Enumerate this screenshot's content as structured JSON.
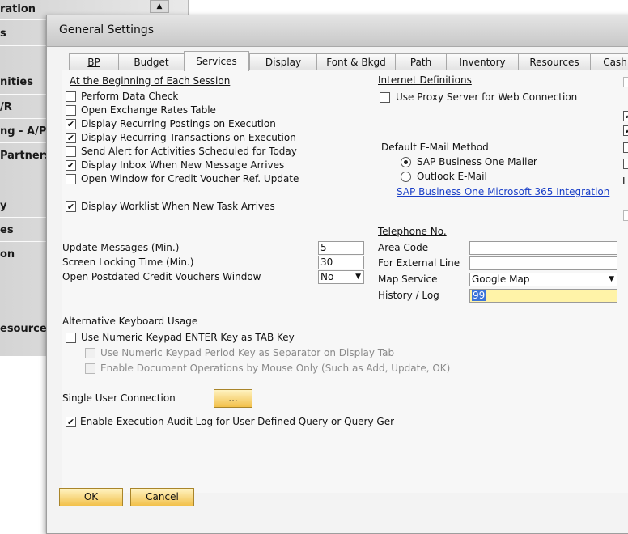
{
  "background": {
    "sidebar_items": [
      "ration",
      "s",
      "nities",
      "/R",
      "ng - A/P",
      " Partners",
      "y",
      "es",
      "on",
      "esource"
    ],
    "scroll_icon": "triangle-up"
  },
  "dialog": {
    "title": "General Settings",
    "tabs": [
      "BP",
      "Budget",
      "Services",
      "Display",
      "Font & Bkgd",
      "Path",
      "Inventory",
      "Resources",
      "Cash"
    ],
    "active_tab": "Services"
  },
  "session": {
    "heading": "At the Beginning of Each Session",
    "options": [
      {
        "label": "Perform Data Check",
        "checked": false
      },
      {
        "label": "Open Exchange Rates Table",
        "checked": false
      },
      {
        "label": "Display Recurring Postings on Execution",
        "checked": true
      },
      {
        "label": "Display Recurring Transactions on Execution",
        "checked": true
      },
      {
        "label": "Send Alert for Activities Scheduled for Today",
        "checked": false
      },
      {
        "label": "Display Inbox When New Message Arrives",
        "checked": true
      },
      {
        "label": "Open Window for Credit Voucher Ref. Update",
        "checked": false
      }
    ],
    "worklist": {
      "label": "Display Worklist When New Task Arrives",
      "checked": true
    }
  },
  "settings": {
    "update_messages": {
      "label": "Update Messages (Min.)",
      "value": "5"
    },
    "screen_locking": {
      "label": "Screen Locking Time (Min.)",
      "value": "30"
    },
    "postdated": {
      "label": "Open Postdated Credit Vouchers Window",
      "value": "No"
    }
  },
  "keyboard": {
    "heading": "Alternative Keyboard Usage",
    "numeric_enter": {
      "label": "Use Numeric Keypad ENTER Key as TAB Key",
      "checked": false
    },
    "numeric_period": {
      "label": "Use Numeric Keypad Period Key as Separator on Display Tab",
      "checked": false
    },
    "mouse_only": {
      "label": "Enable Document Operations by Mouse Only (Such as Add, Update, OK)",
      "checked": false
    }
  },
  "single_user": {
    "label": "Single User Connection",
    "button": "..."
  },
  "audit_log": {
    "label": "Enable Execution Audit Log for User-Defined Query or Query Generato",
    "checked": true
  },
  "internet": {
    "heading": "Internet Definitions",
    "proxy": {
      "label": "Use Proxy Server for Web Connection",
      "checked": false
    }
  },
  "email": {
    "heading": "Default E-Mail Method",
    "options": [
      {
        "label": "SAP Business One Mailer",
        "selected": true
      },
      {
        "label": "Outlook E-Mail",
        "selected": false
      }
    ],
    "link": "SAP Business One Microsoft 365 Integration"
  },
  "telephone": {
    "heading": "Telephone No.",
    "area_code": {
      "label": "Area Code",
      "value": ""
    },
    "external_line": {
      "label": "For External Line",
      "value": ""
    },
    "map_service": {
      "label": "Map Service",
      "value": "Google Map"
    },
    "history_log": {
      "label": "History / Log",
      "value": "99"
    }
  },
  "right_edge": {
    "label_fragment": "I"
  },
  "buttons": {
    "ok": "OK",
    "cancel": "Cancel"
  },
  "colors": {
    "button_gradient_top": "#fff3c2",
    "button_gradient_bottom": "#f2c04a",
    "link": "#1a3fc7",
    "highlight_field": "#fff3a8"
  }
}
